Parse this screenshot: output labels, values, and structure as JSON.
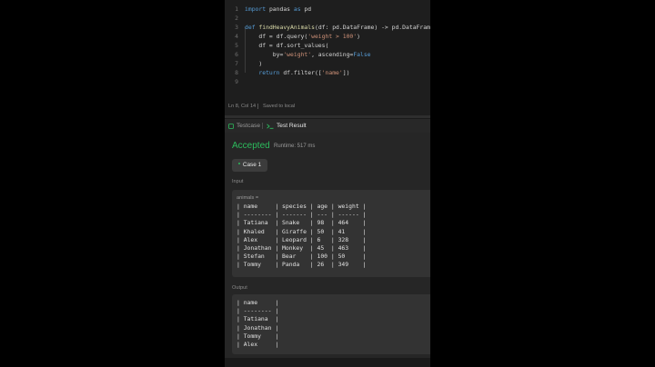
{
  "editor": {
    "lines": [
      {
        "num": "1",
        "tokens": [
          {
            "t": "import",
            "c": "kw"
          },
          {
            "t": " pandas "
          },
          {
            "t": "as",
            "c": "kw"
          },
          {
            "t": " pd"
          }
        ]
      },
      {
        "num": "2",
        "tokens": []
      },
      {
        "num": "3",
        "tokens": [
          {
            "t": "def",
            "c": "kw"
          },
          {
            "t": " "
          },
          {
            "t": "findHeavyAnimals",
            "c": "fn"
          },
          {
            "t": "(df: pd.DataFrame) -> pd.DataFrame:"
          }
        ]
      },
      {
        "num": "4",
        "tokens": [
          {
            "t": "    df = df.query("
          },
          {
            "t": "'weight > 100'",
            "c": "str"
          },
          {
            "t": ")"
          }
        ]
      },
      {
        "num": "5",
        "tokens": [
          {
            "t": "    df = df.sort_values("
          }
        ]
      },
      {
        "num": "6",
        "tokens": [
          {
            "t": "        by="
          },
          {
            "t": "'weight'",
            "c": "str"
          },
          {
            "t": ", ascending="
          },
          {
            "t": "False",
            "c": "kw"
          }
        ]
      },
      {
        "num": "7",
        "tokens": [
          {
            "t": "    )"
          }
        ]
      },
      {
        "num": "8",
        "tokens": [
          {
            "t": "    "
          },
          {
            "t": "return",
            "c": "kw"
          },
          {
            "t": " df.filter(["
          },
          {
            "t": "'name'",
            "c": "str"
          },
          {
            "t": "])"
          }
        ]
      },
      {
        "num": "9",
        "tokens": []
      }
    ],
    "status": {
      "cursor": "Ln 8, Col 14",
      "save": "Saved to local"
    }
  },
  "tabs": {
    "testcase": "Testcase",
    "result": "Test Result"
  },
  "result": {
    "status": "Accepted",
    "runtime": "Runtime: 517 ms",
    "case_label": "Case 1",
    "input_label": "Input",
    "input_var": "animals =",
    "input_table": [
      "| name     | species | age | weight |",
      "| -------- | ------- | --- | ------ |",
      "| Tatiana  | Snake   | 98  | 464    |",
      "| Khaled   | Giraffe | 50  | 41     |",
      "| Alex     | Leopard | 6   | 328    |",
      "| Jonathan | Monkey  | 45  | 463    |",
      "| Stefan   | Bear    | 100 | 50     |",
      "| Tommy    | Panda   | 26  | 349    |"
    ],
    "output_label": "Output",
    "output_table": [
      "| name     |",
      "| -------- |",
      "| Tatiana  |",
      "| Jonathan |",
      "| Tommy    |",
      "| Alex     |"
    ]
  },
  "colors": {
    "accepted": "#2cbb5d",
    "keyword": "#569cd6",
    "string": "#ce9178",
    "function": "#dcdcaa"
  }
}
